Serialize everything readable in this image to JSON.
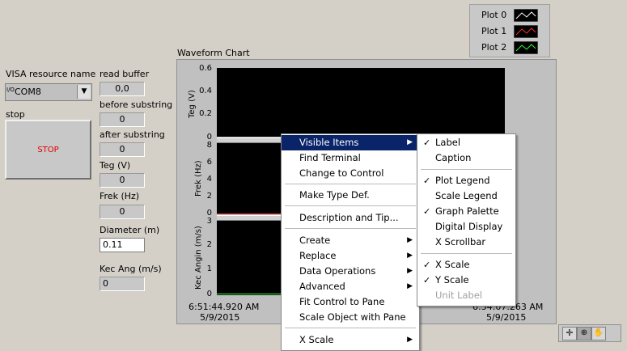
{
  "legend": {
    "items": [
      {
        "label": "Plot 0",
        "color": "#ffffff"
      },
      {
        "label": "Plot 1",
        "color": "#ff3030"
      },
      {
        "label": "Plot 2",
        "color": "#30ff30"
      }
    ]
  },
  "left": {
    "visa_label": "VISA resource name",
    "visa_prefix": "I/O",
    "visa_value": "COM8",
    "stop_label": "stop",
    "stop_button": "STOP",
    "read_buffer_label": "read buffer",
    "read_buffer_value": "0,0",
    "before_label": "before substring",
    "before_value": "0",
    "after_label": "after substring",
    "after_value": "0",
    "teg_label": "Teg (V)",
    "teg_value": "0",
    "frek_label": "Frek (Hz)",
    "frek_value": "0",
    "diameter_label": "Diameter (m)",
    "diameter_value": "0.11",
    "kec_label": "Kec Ang (m/s)",
    "kec_value": "0"
  },
  "chart": {
    "title": "Waveform Chart",
    "pane1": {
      "ylabel": "Teg (V)",
      "ticks": [
        "0.6",
        "0.4",
        "0.2",
        "0"
      ]
    },
    "pane2": {
      "ylabel": "Frek (Hz)",
      "ticks": [
        "8",
        "6",
        "4",
        "2",
        "0"
      ]
    },
    "pane3": {
      "ylabel": "Kec Angin (m/s)",
      "ticks": [
        "3",
        "2",
        "1",
        "0"
      ]
    },
    "xstart_time": "6:51:44.920 AM",
    "xstart_date": "5/9/2015",
    "xend_time": "6:54:07.263 AM",
    "xend_date": "5/9/2015"
  },
  "context_menu": {
    "items": [
      {
        "label": "Visible Items",
        "submenu": true,
        "highlighted": true
      },
      {
        "label": "Find Terminal"
      },
      {
        "label": "Change to Control"
      },
      {
        "label": "Make Type Def."
      },
      {
        "label": "Description and Tip..."
      },
      {
        "label": "Create",
        "submenu": true
      },
      {
        "label": "Replace",
        "submenu": true
      },
      {
        "label": "Data Operations",
        "submenu": true
      },
      {
        "label": "Advanced",
        "submenu": true
      },
      {
        "label": "Fit Control to Pane"
      },
      {
        "label": "Scale Object with Pane"
      },
      {
        "label": "X Scale",
        "submenu": true
      }
    ]
  },
  "submenu": {
    "items": [
      {
        "label": "Label",
        "checked": true
      },
      {
        "label": "Caption",
        "checked": false
      },
      {
        "label": "Plot Legend",
        "checked": true
      },
      {
        "label": "Scale Legend",
        "checked": false
      },
      {
        "label": "Graph Palette",
        "checked": true
      },
      {
        "label": "Digital Display",
        "checked": false
      },
      {
        "label": "X Scrollbar",
        "checked": false
      },
      {
        "label": "X Scale",
        "checked": true
      },
      {
        "label": "Y Scale",
        "checked": true
      },
      {
        "label": "Unit Label",
        "checked": false,
        "disabled": true
      }
    ]
  },
  "check_glyph": "✓",
  "arrow_glyph": "▶"
}
